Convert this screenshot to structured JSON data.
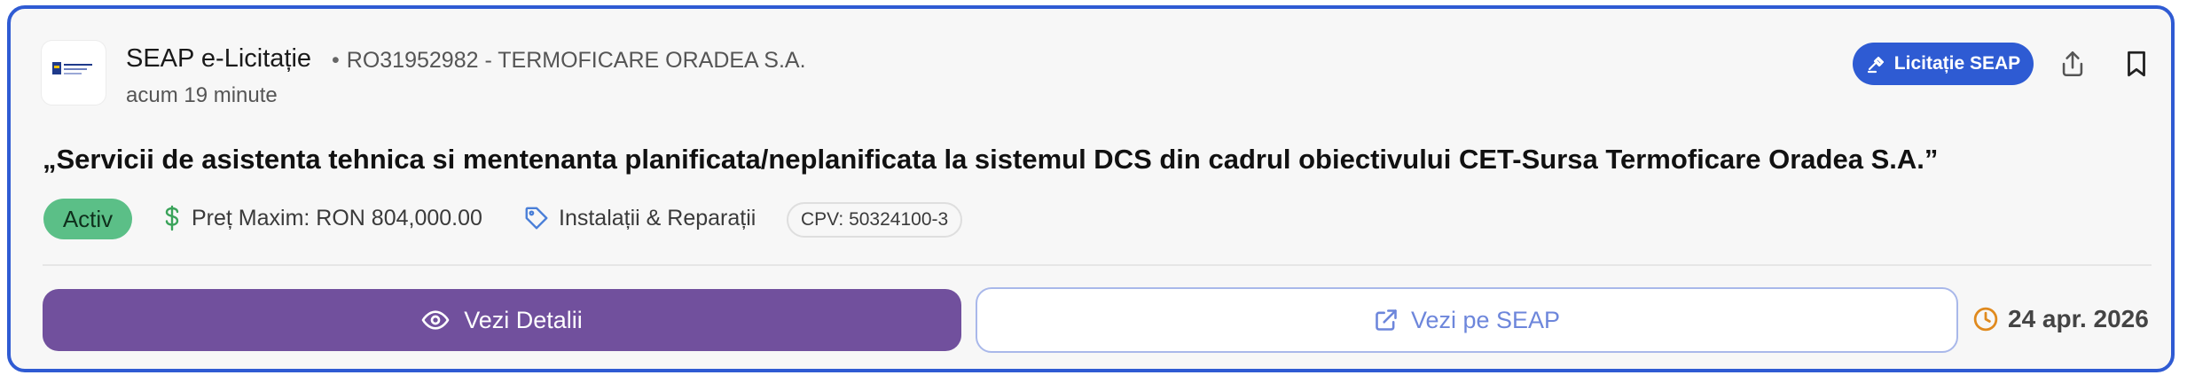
{
  "header": {
    "source_name": "SEAP e-Licitație",
    "authority": "RO31952982 - TERMOFICARE ORADEA S.A.",
    "separator": "•",
    "time_ago": "acum 19 minute",
    "type_badge": "Licitație SEAP"
  },
  "title": "„Servicii de asistenta tehnica si mentenanta planificata/neplanificata la sistemul DCS din cadrul obiectivului CET-Sursa Termoficare Oradea S.A.”",
  "tags": {
    "status": "Activ",
    "price": "Preț Maxim: RON 804,000.00",
    "category": "Instalații & Reparații",
    "cpv": "CPV: 50324100-3"
  },
  "actions": {
    "details_label": "Vezi Detalii",
    "seap_label": "Vezi pe SEAP"
  },
  "deadline": "24 apr. 2026",
  "colors": {
    "border": "#2f5bd3",
    "badge_blue": "#2e5bd3",
    "status_green": "#5bbf87",
    "primary_purple": "#71509d",
    "link_blue": "#6d86db",
    "clock_orange": "#e08a1e",
    "dollar_green": "#3aa35a",
    "tag_blue": "#4a7fd8"
  },
  "icons": {
    "logo": "authority-logo",
    "gavel": "gavel-icon",
    "share": "share-icon",
    "bookmark": "bookmark-icon",
    "dollar": "dollar-icon",
    "tag": "tag-icon",
    "eye": "eye-icon",
    "external": "external-link-icon",
    "clock": "clock-icon"
  }
}
